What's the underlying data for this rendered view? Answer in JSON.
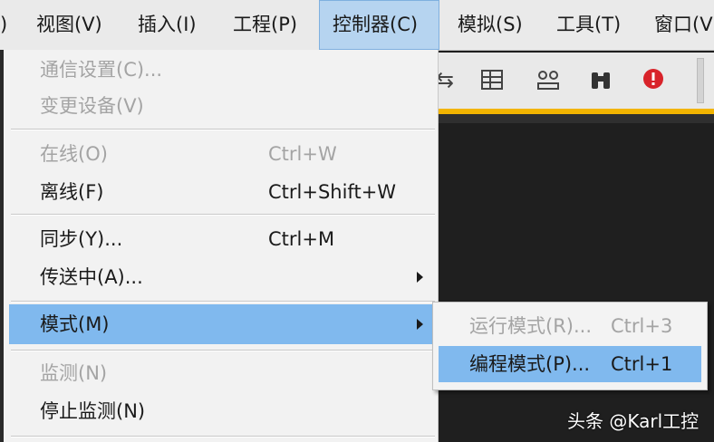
{
  "menubar": {
    "items": [
      {
        "label": ")"
      },
      {
        "label": "视图(V)"
      },
      {
        "label": "插入(I)"
      },
      {
        "label": "工程(P)"
      },
      {
        "label": "控制器(C)"
      },
      {
        "label": "模拟(S)"
      },
      {
        "label": "工具(T)"
      },
      {
        "label": "窗口(V"
      }
    ]
  },
  "toolbar": {
    "icons": [
      "compare-icon",
      "table-icon",
      "network-icon",
      "binoculars-icon",
      "alert-icon"
    ]
  },
  "dropdown": {
    "items": [
      {
        "label": "通信设置(C)...",
        "shortcut": "",
        "disabled": true
      },
      {
        "label": "变更设备(V)",
        "shortcut": "",
        "disabled": true
      },
      {
        "label": "在线(O)",
        "shortcut": "Ctrl+W",
        "disabled": true
      },
      {
        "label": "离线(F)",
        "shortcut": "Ctrl+Shift+W",
        "disabled": false
      },
      {
        "label": "同步(Y)...",
        "shortcut": "Ctrl+M",
        "disabled": false
      },
      {
        "label": "传送中(A)...",
        "shortcut": "",
        "disabled": false,
        "submenu": true
      },
      {
        "label": "模式(M)",
        "shortcut": "",
        "disabled": false,
        "submenu": true,
        "highlighted": true
      },
      {
        "label": "监测(N)",
        "shortcut": "",
        "disabled": true
      },
      {
        "label": "停止监测(N)",
        "shortcut": "",
        "disabled": false
      }
    ]
  },
  "submenu": {
    "items": [
      {
        "label": "运行模式(R)...",
        "shortcut": "Ctrl+3",
        "disabled": true
      },
      {
        "label": "编程模式(P)...",
        "shortcut": "Ctrl+1",
        "disabled": false,
        "highlighted": true
      }
    ]
  },
  "watermark": "头条 @Karl工控",
  "colors": {
    "menu_active": "#b6d4f0",
    "highlight": "#80b9ee",
    "toolbar_accent": "#f2b400"
  }
}
